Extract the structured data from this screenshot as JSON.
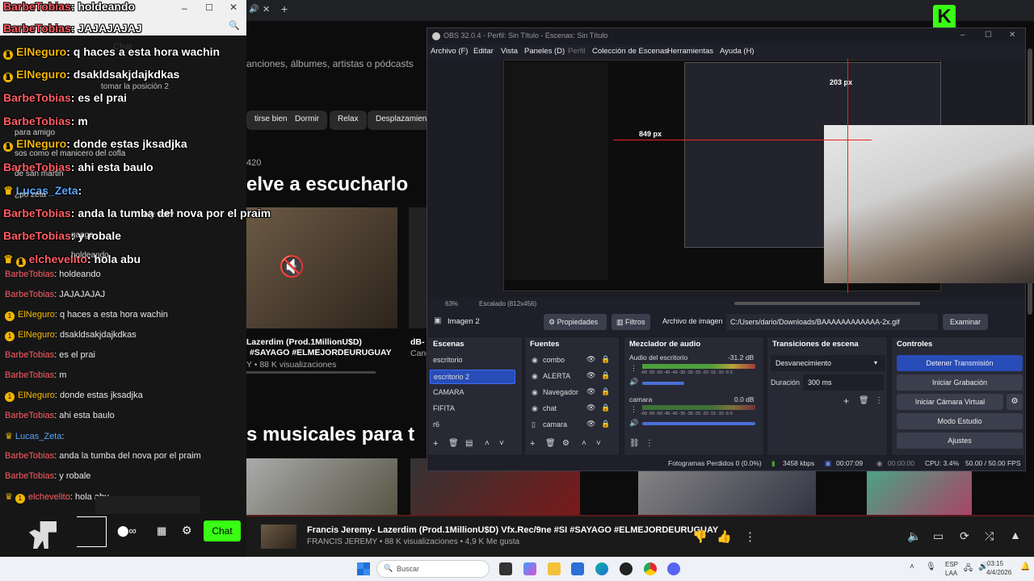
{
  "chat": {
    "overlay": [
      {
        "user": "BarbeTobias",
        "text": ": holdeando",
        "cls": "u",
        "badge": ""
      },
      {
        "user": "BarbeTobias",
        "text": ": JAJAJAJAJ",
        "cls": "u",
        "badge": ""
      },
      {
        "user": "ElNeguro",
        "text": ": q haces a esta hora wachin",
        "cls": "y",
        "badge": "1"
      },
      {
        "user": "ElNeguro",
        "text": ": dsakldsakjdajkdkas",
        "cls": "y",
        "badge": "1"
      },
      {
        "user": "BarbeTobias",
        "text": ": es el prai",
        "cls": "u",
        "badge": ""
      },
      {
        "user": "BarbeTobias",
        "text": ": m",
        "cls": "u",
        "badge": ""
      },
      {
        "user": "ElNeguro",
        "text": ": donde estas jksadjka",
        "cls": "y",
        "badge": "1"
      },
      {
        "user": "BarbeTobias",
        "text": ": ahi esta baulo",
        "cls": "u",
        "badge": ""
      },
      {
        "user": "Lucas_Zeta",
        "text": ":",
        "cls": "b",
        "badge": "crown"
      },
      {
        "user": "BarbeTobias",
        "text": ": anda la tumba del nova por el praim",
        "cls": "u",
        "badge": ""
      },
      {
        "user": "BarbeTobias",
        "text": ": y robale",
        "cls": "u",
        "badge": ""
      },
      {
        "user": "elchevelito",
        "text": ": hola abu",
        "cls": "u",
        "badge": "crown1"
      }
    ],
    "lines": [
      {
        "user": "BarbeTobias",
        "text": ": holdeando",
        "cls": "u",
        "badge": ""
      },
      {
        "user": "BarbeTobias",
        "text": ": JAJAJAJAJ",
        "cls": "u",
        "badge": ""
      },
      {
        "user": "ElNeguro",
        "text": ": q haces a esta hora wachin",
        "cls": "y",
        "badge": "1"
      },
      {
        "user": "ElNeguro",
        "text": ": dsakldsakjdajkdkas",
        "cls": "y",
        "badge": "1"
      },
      {
        "user": "BarbeTobias",
        "text": ": es el prai",
        "cls": "u",
        "badge": ""
      },
      {
        "user": "BarbeTobias",
        "text": ": m",
        "cls": "u",
        "badge": ""
      },
      {
        "user": "ElNeguro",
        "text": ": donde estas jksadjka",
        "cls": "y",
        "badge": "1"
      },
      {
        "user": "BarbeTobias",
        "text": ": ahi esta baulo",
        "cls": "u",
        "badge": ""
      },
      {
        "user": "Lucas_Zeta",
        "text": ":",
        "cls": "b",
        "badge": "crown"
      },
      {
        "user": "BarbeTobias",
        "text": ": anda la tumba del nova por el praim",
        "cls": "u",
        "badge": ""
      },
      {
        "user": "BarbeTobias",
        "text": ": y robale",
        "cls": "u",
        "badge": ""
      },
      {
        "user": "elchevelito",
        "text": ": hola abu",
        "cls": "u",
        "badge": "crown1"
      }
    ],
    "chat_button": "Chat",
    "header_label": "Chat",
    "rank_text": "tomar la posición 2",
    "small_fragments": [
      "para amigo",
      "sos como el manicero del cofla",
      "de san martin",
      "¿po zeta",
      "e y vos?",
      "ganga",
      "holdeando"
    ]
  },
  "yt": {
    "search_placeholder": "anciones, álbumes, artistas o pódcasts",
    "chips": [
      "tirse bien",
      "Dormir",
      "Relax",
      "Desplazamient"
    ],
    "count_label": "420",
    "heading1": "elve a escucharlo",
    "heading2": "s musicales para t",
    "card_title_1": "Lazerdim (Prod.1MillionU$D)",
    "card_title_2": "#SAYAGO #ELMEJORDEURUGUAY",
    "card_meta": "Y • 88 K visualizaciones",
    "card2_a": "dB-",
    "card2_b": "Canc",
    "now_playing_title": "Francis Jeremy- Lazerdim (Prod.1MillionU$D) Vfx.Rec/9ne #SI #SAYAGO #ELMEJORDEURUGUAY",
    "now_playing_meta": "FRANCIS JEREMY • 88 K visualizaciones • 4,9 K Me gusta"
  },
  "obs": {
    "title": "OBS 32.0.4 - Perfil: Sin Título - Escenas: Sin Título",
    "menu": [
      "Archivo (F)",
      "Editar",
      "Vista",
      "Paneles (D)",
      "Perfil",
      "Colección de Escenas",
      "Herramientas",
      "Ayuda (H)"
    ],
    "zoom": "63%",
    "scaled": "Escalado (812x456)",
    "source_name": "Imagen 2",
    "btn_props": "Propiedades",
    "btn_filters": "Filtros",
    "image_file_label": "Archivo de imagen",
    "image_path": "C:/Users/dario/Downloads/BAAAAAAAAAAAA-2x.gif",
    "btn_browse": "Examinar",
    "scenes_title": "Escenas",
    "scenes": [
      "escritorio",
      "escritorio 2",
      "CAMARA",
      "FIFITA",
      "r6"
    ],
    "sources_title": "Fuentes",
    "sources": [
      "combo",
      "ALERTA",
      "Navegador",
      "chat",
      "camara"
    ],
    "mixer_title": "Mezclador de audio",
    "mixer": [
      {
        "name": "Audio del escritorio",
        "db": "-31.2 dB"
      },
      {
        "name": "camara",
        "db": "0.0 dB"
      }
    ],
    "meter_scale": "-60 -55 -50 -45 -40 -35 -30 -25 -20 -15 -10 -5 0",
    "transitions_title": "Transiciones de escena",
    "transition": "Desvanecimiento",
    "duration_label": "Duración",
    "duration": "300 ms",
    "controls_title": "Controles",
    "controls": [
      "Detener Transmisión",
      "Iniciar Grabación",
      "Iniciar Cámara Virtual",
      "Modo Estudio",
      "Ajustes"
    ],
    "status_dropped": "Fotogramas Perdidos 0 (0.0%)",
    "status_kbps": "3458 kbps",
    "status_time1": "00:07:09",
    "status_time2": "00:00:00",
    "status_cpu": "CPU: 3.4%",
    "status_fps": "50.00 / 50.00 FPS",
    "preview_px1": "849 px",
    "preview_px2": "203 px"
  },
  "taskbar": {
    "search": "Buscar",
    "lang1": "ESP",
    "lang2": "LAA",
    "time": "03:15",
    "date": "4/4/2026"
  },
  "colors": {
    "accent": "#284cb8",
    "chat_green": "#39ff14",
    "user_red": "#ff5c63",
    "user_gold": "#f3b700"
  }
}
